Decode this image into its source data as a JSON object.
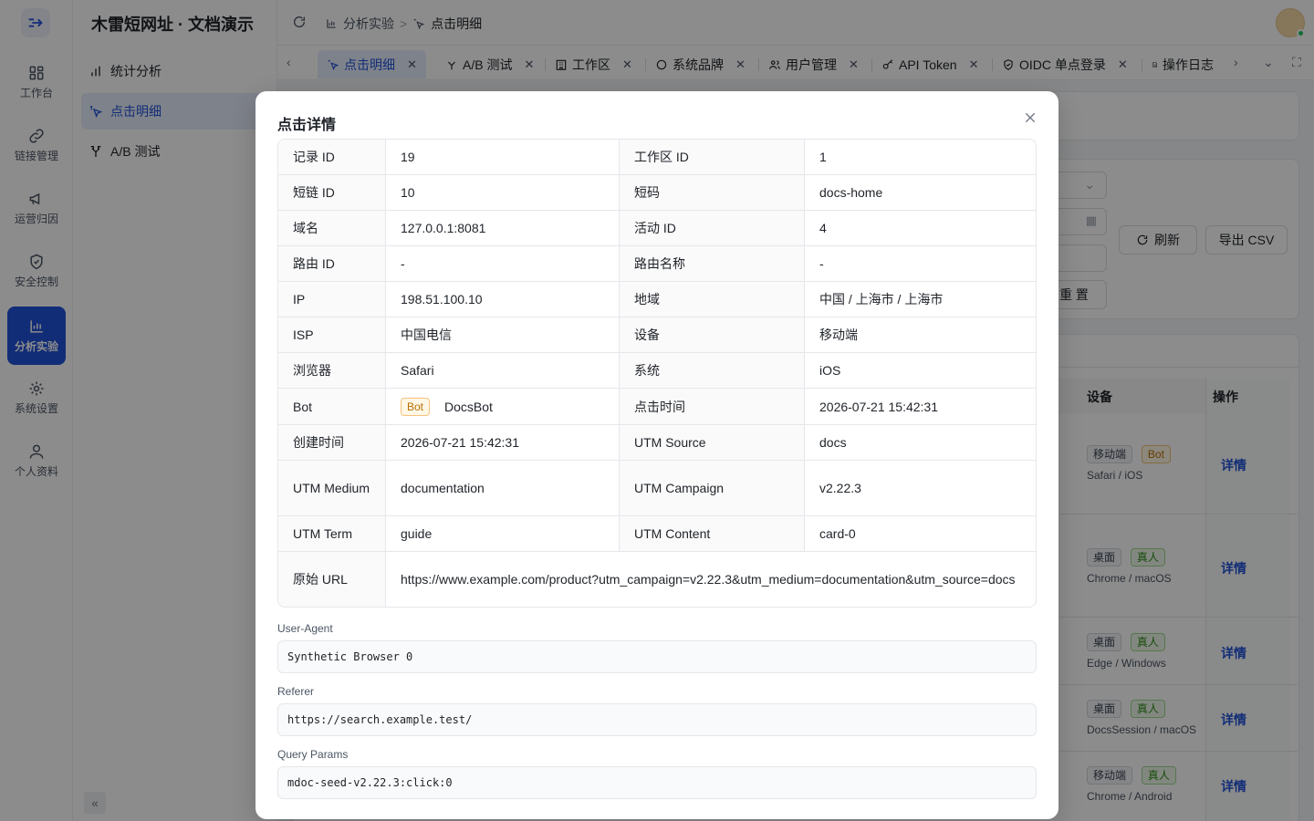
{
  "app": {
    "title": "木雷短网址 · 文档演示"
  },
  "rail": [
    {
      "label": "工作台",
      "icon": "dashboard-icon"
    },
    {
      "label": "链接管理",
      "icon": "link-icon"
    },
    {
      "label": "运营归因",
      "icon": "megaphone-icon"
    },
    {
      "label": "安全控制",
      "icon": "shield-icon"
    },
    {
      "label": "分析实验",
      "icon": "chart-icon",
      "active": true
    },
    {
      "label": "系统设置",
      "icon": "gear-icon"
    },
    {
      "label": "个人资料",
      "icon": "user-icon"
    }
  ],
  "sidebar": {
    "items": [
      {
        "label": "统计分析",
        "icon": "bar-chart-icon"
      },
      {
        "label": "点击明细",
        "icon": "click-icon",
        "active": true
      },
      {
        "label": "A/B 测试",
        "icon": "split-icon"
      }
    ],
    "collapse": "«"
  },
  "breadcrumb": {
    "parent": "分析实验",
    "current": "点击明细",
    "sep": ">"
  },
  "tabs": [
    {
      "label": "点击明细",
      "active": true
    },
    {
      "label": "A/B 测试"
    },
    {
      "label": "工作区"
    },
    {
      "label": "系统品牌"
    },
    {
      "label": "用户管理"
    },
    {
      "label": "API Token"
    },
    {
      "label": "OIDC 单点登录"
    },
    {
      "label": "操作日志"
    }
  ],
  "background": {
    "refresh_label": "刷新",
    "export_label": "导出 CSV",
    "reset_label": "重 置",
    "columns": {
      "device": "设备",
      "action": "操作"
    },
    "rows": [
      {
        "tags": [
          "移动端",
          "Bot"
        ],
        "sub": "Safari / iOS",
        "action": "详情"
      },
      {
        "tags": [
          "桌面",
          "真人"
        ],
        "sub": "Chrome / macOS",
        "action": "详情"
      },
      {
        "tags": [
          "桌面",
          "真人"
        ],
        "sub": "Edge / Windows",
        "action": "详情"
      },
      {
        "tags": [
          "桌面",
          "真人"
        ],
        "sub": "DocsSession / macOS",
        "action": "详情"
      },
      {
        "tags": [
          "移动端",
          "真人"
        ],
        "sub": "Chrome / Android",
        "action": "详情"
      }
    ]
  },
  "modal": {
    "title": "点击详情",
    "details": [
      {
        "k1": "记录 ID",
        "v1": "19",
        "k2": "工作区 ID",
        "v2": "1"
      },
      {
        "k1": "短链 ID",
        "v1": "10",
        "k2": "短码",
        "v2": "docs-home"
      },
      {
        "k1": "域名",
        "v1": "127.0.0.1:8081",
        "k2": "活动 ID",
        "v2": "4"
      },
      {
        "k1": "路由 ID",
        "v1": "-",
        "k2": "路由名称",
        "v2": "-"
      },
      {
        "k1": "IP",
        "v1": "198.51.100.10",
        "k2": "地域",
        "v2": "中国 / 上海市 / 上海市"
      },
      {
        "k1": "ISP",
        "v1": "中国电信",
        "k2": "设备",
        "v2": "移动端"
      },
      {
        "k1": "浏览器",
        "v1": "Safari",
        "k2": "系统",
        "v2": "iOS"
      },
      {
        "k1": "Bot",
        "v1_tag": "Bot",
        "v1": "DocsBot",
        "k2": "点击时间",
        "v2": "2026-07-21 15:42:31"
      },
      {
        "k1": "创建时间",
        "v1": "2026-07-21 15:42:31",
        "k2": "UTM Source",
        "v2": "docs"
      },
      {
        "k1": "UTM Medium",
        "v1": "documentation",
        "k2": "UTM Campaign",
        "v2": "v2.22.3"
      },
      {
        "k1": "UTM Term",
        "v1": "guide",
        "k2": "UTM Content",
        "v2": "card-0"
      }
    ],
    "raw_url_label": "原始 URL",
    "raw_url": "https://www.example.com/product?utm_campaign=v2.22.3&utm_medium=documentation&utm_source=docs",
    "user_agent_label": "User-Agent",
    "user_agent": "Synthetic Browser 0",
    "referer_label": "Referer",
    "referer": "https://search.example.test/",
    "query_label": "Query Params",
    "query": "mdoc-seed-v2.22.3:click:0"
  },
  "colors": {
    "accent": "#2152d9",
    "bot_tag": "#b76e00",
    "human_tag": "#2f8a17"
  }
}
